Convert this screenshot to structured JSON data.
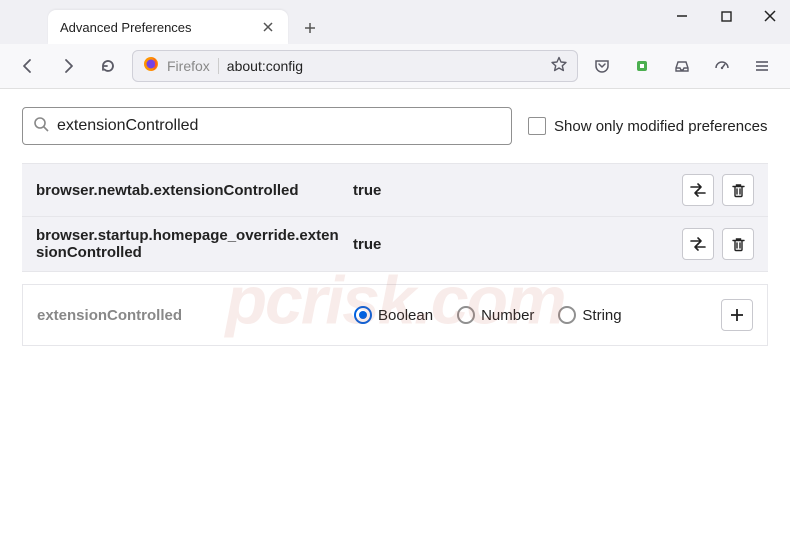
{
  "window": {
    "tab_title": "Advanced Preferences"
  },
  "urlbar": {
    "ff_label": "Firefox",
    "url": "about:config"
  },
  "search": {
    "value": "extensionControlled"
  },
  "checkbox": {
    "label": "Show only modified preferences"
  },
  "prefs": [
    {
      "name": "browser.newtab.extensionControlled",
      "value": "true"
    },
    {
      "name": "browser.startup.homepage_override.extensionControlled",
      "value": "true"
    }
  ],
  "add": {
    "name": "extensionControlled",
    "types": {
      "boolean": "Boolean",
      "number": "Number",
      "string": "String"
    }
  },
  "watermark": "pcrisk.com"
}
